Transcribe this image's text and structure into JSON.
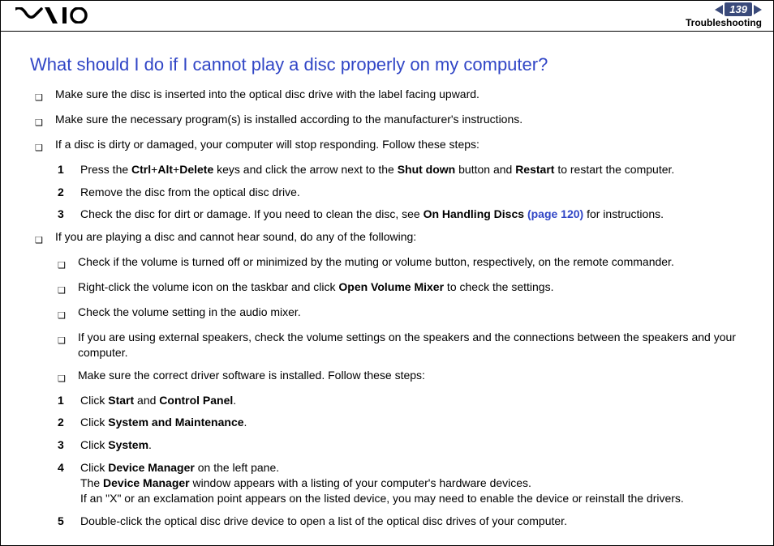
{
  "header": {
    "page_number": "139",
    "section": "Troubleshooting"
  },
  "title": "What should I do if I cannot play a disc properly on my computer?",
  "b1": "Make sure the disc is inserted into the optical disc drive with the label facing upward.",
  "b2": "Make sure the necessary program(s) is installed according to the manufacturer's instructions.",
  "b3": "If a disc is dirty or damaged, your computer will stop responding. Follow these steps:",
  "s1_n": "1",
  "s1_a": "Press the ",
  "s1_ctrl": "Ctrl",
  "s1_plus1": "+",
  "s1_alt": "Alt",
  "s1_plus2": "+",
  "s1_del": "Delete",
  "s1_b": " keys and click the arrow next to the ",
  "s1_shut": "Shut down",
  "s1_c": " button and ",
  "s1_restart": "Restart",
  "s1_d": " to restart the computer.",
  "s2_n": "2",
  "s2": "Remove the disc from the optical disc drive.",
  "s3_n": "3",
  "s3_a": "Check the disc for dirt or damage. If you need to clean the disc, see ",
  "s3_b": "On Handling Discs ",
  "s3_link": "(page 120)",
  "s3_c": " for instructions.",
  "b4": "If you are playing a disc and cannot hear sound, do any of the following:",
  "sb1": "Check if the volume is turned off or minimized by the muting or volume button, respectively, on the remote commander.",
  "sb2_a": "Right-click the volume icon on the taskbar and click ",
  "sb2_b": "Open Volume Mixer",
  "sb2_c": " to check the settings.",
  "sb3": "Check the volume setting in the audio mixer.",
  "sb4": "If you are using external speakers, check the volume settings on the speakers and the connections between the speakers and your computer.",
  "sb5": "Make sure the correct driver software is installed. Follow these steps:",
  "d1_n": "1",
  "d1_a": "Click ",
  "d1_start": "Start",
  "d1_and": " and ",
  "d1_cp": "Control Panel",
  "d1_dot": ".",
  "d2_n": "2",
  "d2_a": "Click ",
  "d2_b": "System and Maintenance",
  "d2_dot": ".",
  "d3_n": "3",
  "d3_a": "Click ",
  "d3_b": "System",
  "d3_dot": ".",
  "d4_n": "4",
  "d4_a": "Click ",
  "d4_b": "Device Manager",
  "d4_c": " on the left pane.",
  "d4_line2a": "The ",
  "d4_line2b": "Device Manager",
  "d4_line2c": " window appears with a listing of your computer's hardware devices.",
  "d4_line3": "If an \"X\" or an exclamation point appears on the listed device, you may need to enable the device or reinstall the drivers.",
  "d5_n": "5",
  "d5": "Double-click the optical disc drive device to open a list of the optical disc drives of your computer."
}
